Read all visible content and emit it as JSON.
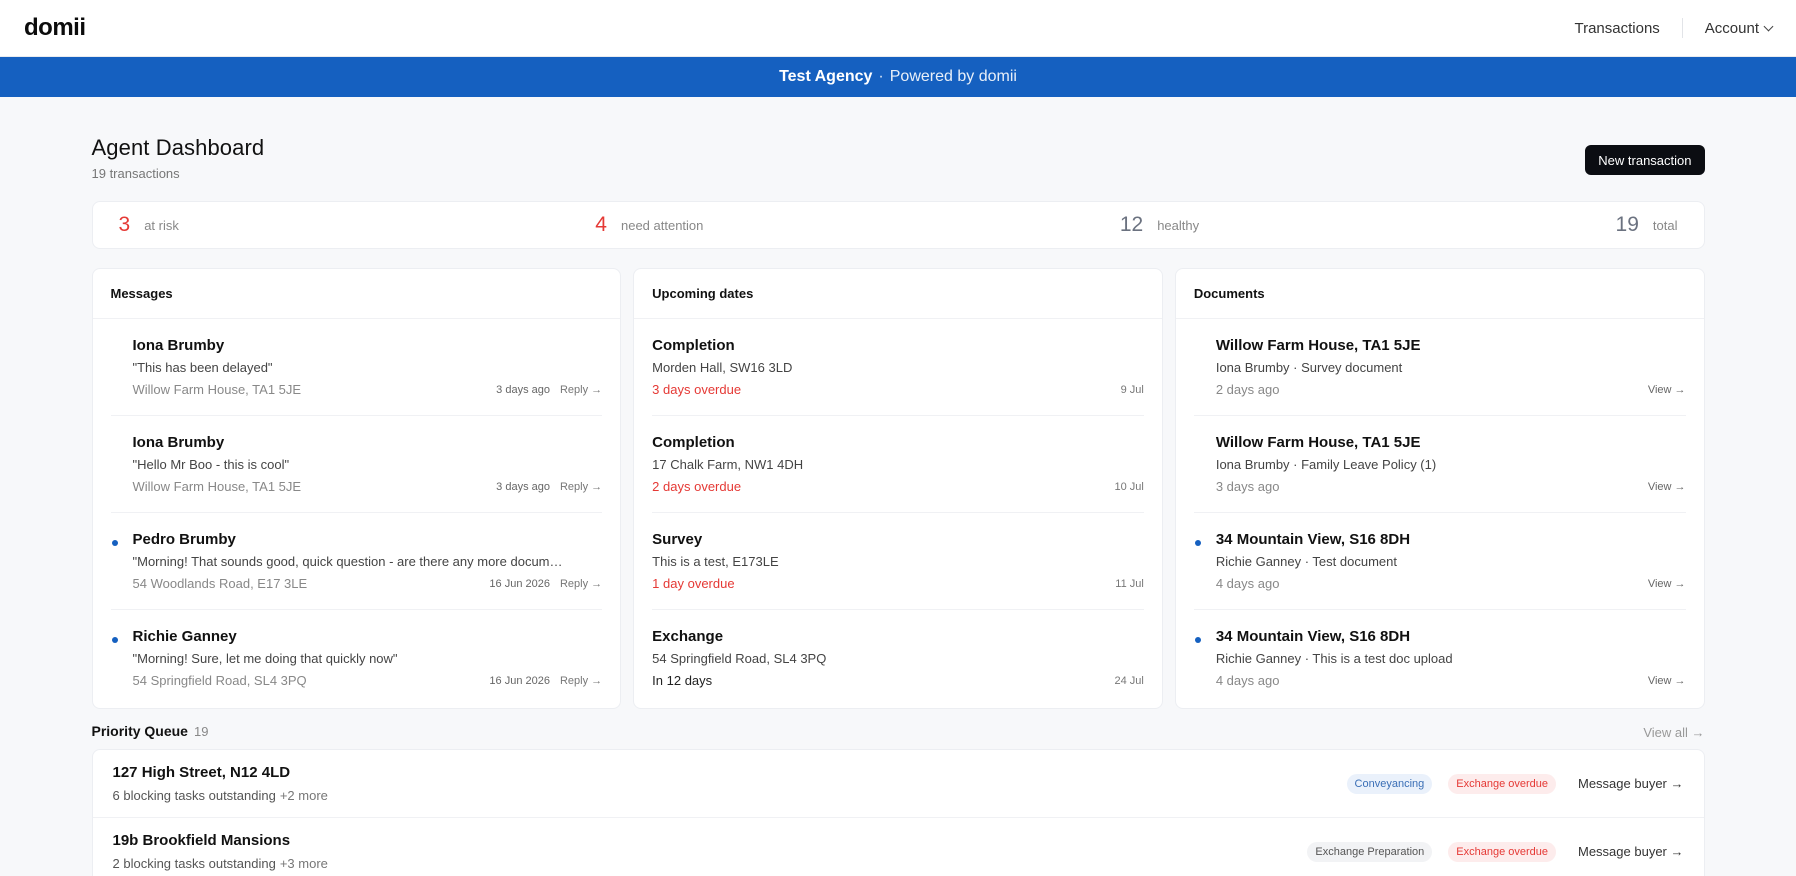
{
  "app": {
    "logo": "domii"
  },
  "nav": {
    "transactions": "Transactions",
    "account": "Account"
  },
  "banner": {
    "agency": "Test Agency",
    "separator": "·",
    "powered": "Powered by domii"
  },
  "header": {
    "title": "Agent Dashboard",
    "subtitle": "19 transactions",
    "new_button": "New transaction"
  },
  "stats": [
    {
      "value": "3",
      "label": "at risk"
    },
    {
      "value": "4",
      "label": "need attention"
    },
    {
      "value": "12",
      "label": "healthy"
    },
    {
      "value": "19",
      "label": "total"
    }
  ],
  "messages": {
    "title": "Messages",
    "items": [
      {
        "name": "Iona Brumby",
        "text": "\"This has been delayed\"",
        "property": "Willow Farm House, TA1 5JE",
        "time": "3 days ago",
        "action": "Reply →"
      },
      {
        "name": "Iona Brumby",
        "text": "\"Hello Mr Boo - this is cool\"",
        "property": "Willow Farm House, TA1 5JE",
        "time": "3 days ago",
        "action": "Reply →"
      },
      {
        "name": "Pedro Brumby",
        "text": "\"Morning! That sounds good, quick question - are there any more documents I need to send over?\"",
        "property": "54 Woodlands Road, E17 3LE",
        "time": "16 Jun 2026",
        "action": "Reply →"
      },
      {
        "name": "Richie Ganney",
        "text": "\"Morning! Sure, let me doing that quickly now\"",
        "property": "54 Springfield Road, SL4 3PQ",
        "time": "16 Jun 2026",
        "action": "Reply →"
      }
    ]
  },
  "dates": {
    "title": "Upcoming dates",
    "items": [
      {
        "event": "Completion",
        "property": "Morden Hall, SW16 3LD",
        "status": "3 days overdue",
        "date": "9 Jul"
      },
      {
        "event": "Completion",
        "property": "17 Chalk Farm, NW1 4DH",
        "status": "2 days overdue",
        "date": "10 Jul"
      },
      {
        "event": "Survey",
        "property": "This is a test, E173LE",
        "status": "1 day overdue",
        "date": "11 Jul"
      },
      {
        "event": "Exchange",
        "property": "54 Springfield Road, SL4 3PQ",
        "status": "In 12 days",
        "date": "24 Jul"
      }
    ]
  },
  "documents": {
    "title": "Documents",
    "items": [
      {
        "property": "Willow Farm House, TA1 5JE",
        "detail": "Iona Brumby · Survey document",
        "time": "2 days ago",
        "action": "View →"
      },
      {
        "property": "Willow Farm House, TA1 5JE",
        "detail": "Iona Brumby ·  Family Leave Policy (1)",
        "time": "3 days ago",
        "action": "View →"
      },
      {
        "property": "34 Mountain View, S16 8DH",
        "detail": "Richie Ganney · Test document",
        "time": "4 days ago",
        "action": "View →"
      },
      {
        "property": "34 Mountain View, S16 8DH",
        "detail": "Richie Ganney ·  This is a test doc upload",
        "time": "4 days ago",
        "action": "View →"
      }
    ]
  },
  "priority": {
    "title": "Priority Queue",
    "count": "19",
    "view_all": "View all →",
    "items": [
      {
        "address": "127 High Street, N12 4LD",
        "blocking": "6 blocking tasks outstanding",
        "more": "+2 more",
        "stage": "Conveyancing",
        "flag": "Exchange overdue",
        "action": "Message buyer →"
      },
      {
        "address": "19b Brookfield Mansions",
        "blocking": "2 blocking tasks outstanding",
        "more": "+3 more",
        "stage": "Exchange Preparation",
        "flag": "Exchange overdue",
        "action": "Message buyer →"
      }
    ]
  },
  "colors": {
    "brand_blue": "#1560c0",
    "danger_red": "#e53935",
    "dark_button": "#0b0d12"
  }
}
